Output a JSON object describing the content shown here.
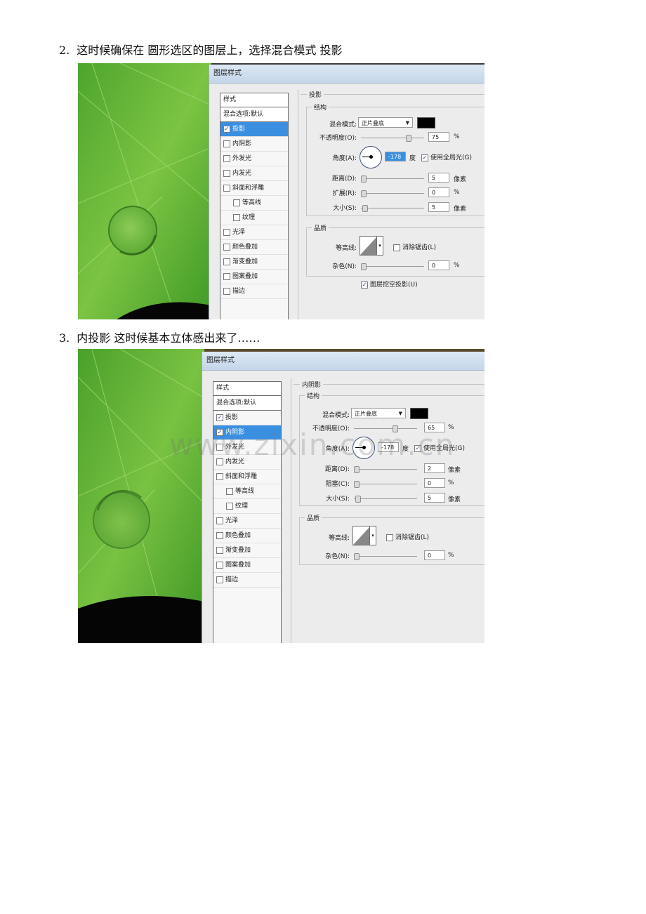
{
  "steps": [
    {
      "number": "2.",
      "text": "这时候确保在 圆形选区的图层上，选择混合模式 投影"
    },
    {
      "number": "3.",
      "text": "内投影 这时候基本立体感出来了……"
    }
  ],
  "dialog_title": "图层样式",
  "style_list": {
    "header": "样式",
    "blend_options": "混合选项:默认",
    "items": [
      "投影",
      "内阴影",
      "外发光",
      "内发光",
      "斜面和浮雕",
      "等高线",
      "纹理",
      "光泽",
      "颜色叠加",
      "渐变叠加",
      "图案叠加",
      "描边"
    ]
  },
  "panel1": {
    "section": "投影",
    "structure": "结构",
    "blend_mode_label": "混合模式:",
    "blend_mode": "正片叠底",
    "opacity_label": "不透明度(O):",
    "opacity": "75",
    "angle_label": "角度(A):",
    "angle": "-178",
    "degree_unit": "度",
    "global_light": "使用全局光(G)",
    "distance_label": "距离(D):",
    "distance": "5",
    "spread_label": "扩展(R):",
    "spread": "0",
    "size_label": "大小(S):",
    "size": "5",
    "quality": "品质",
    "contour_label": "等高线:",
    "antialias": "消除锯齿(L)",
    "noise_label": "杂色(N):",
    "noise": "0",
    "knockout": "图层挖空投影(U)",
    "px_unit": "像素",
    "pct_unit": "%"
  },
  "panel2": {
    "section": "内阴影",
    "structure": "结构",
    "blend_mode_label": "混合模式:",
    "blend_mode": "正片叠底",
    "opacity_label": "不透明度(O):",
    "opacity": "65",
    "angle_label": "角度(A):",
    "angle": "-178",
    "degree_unit": "度",
    "global_light": "使用全局光(G)",
    "distance_label": "距离(D):",
    "distance": "2",
    "choke_label": "阻塞(C):",
    "choke": "0",
    "size_label": "大小(S):",
    "size": "5",
    "quality": "品质",
    "contour_label": "等高线:",
    "antialias": "消除锯齿(L)",
    "noise_label": "杂色(N):",
    "noise": "0",
    "px_unit": "像素",
    "pct_unit": "%"
  },
  "watermark": "www.zixin.com.cn",
  "colors": {
    "leaf_light": "#8fd04e",
    "leaf_dark": "#2f8a1f",
    "selection": "#3b8fe0",
    "dialog_bg": "#ececec",
    "shadow_color": "#000000"
  }
}
